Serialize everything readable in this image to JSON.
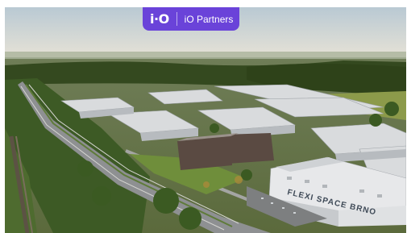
{
  "badge": {
    "logo_text": "i·O",
    "label": "iO Partners",
    "background": "#6a43d9"
  },
  "photo": {
    "subject": "aerial photograph of a business park beside a highway",
    "sign_text": "FLEXI SPACE BRNO",
    "sky_color": "#c9d6de",
    "foliage_color": "#3f5a2c",
    "roof_color": "#d9dbdd"
  }
}
